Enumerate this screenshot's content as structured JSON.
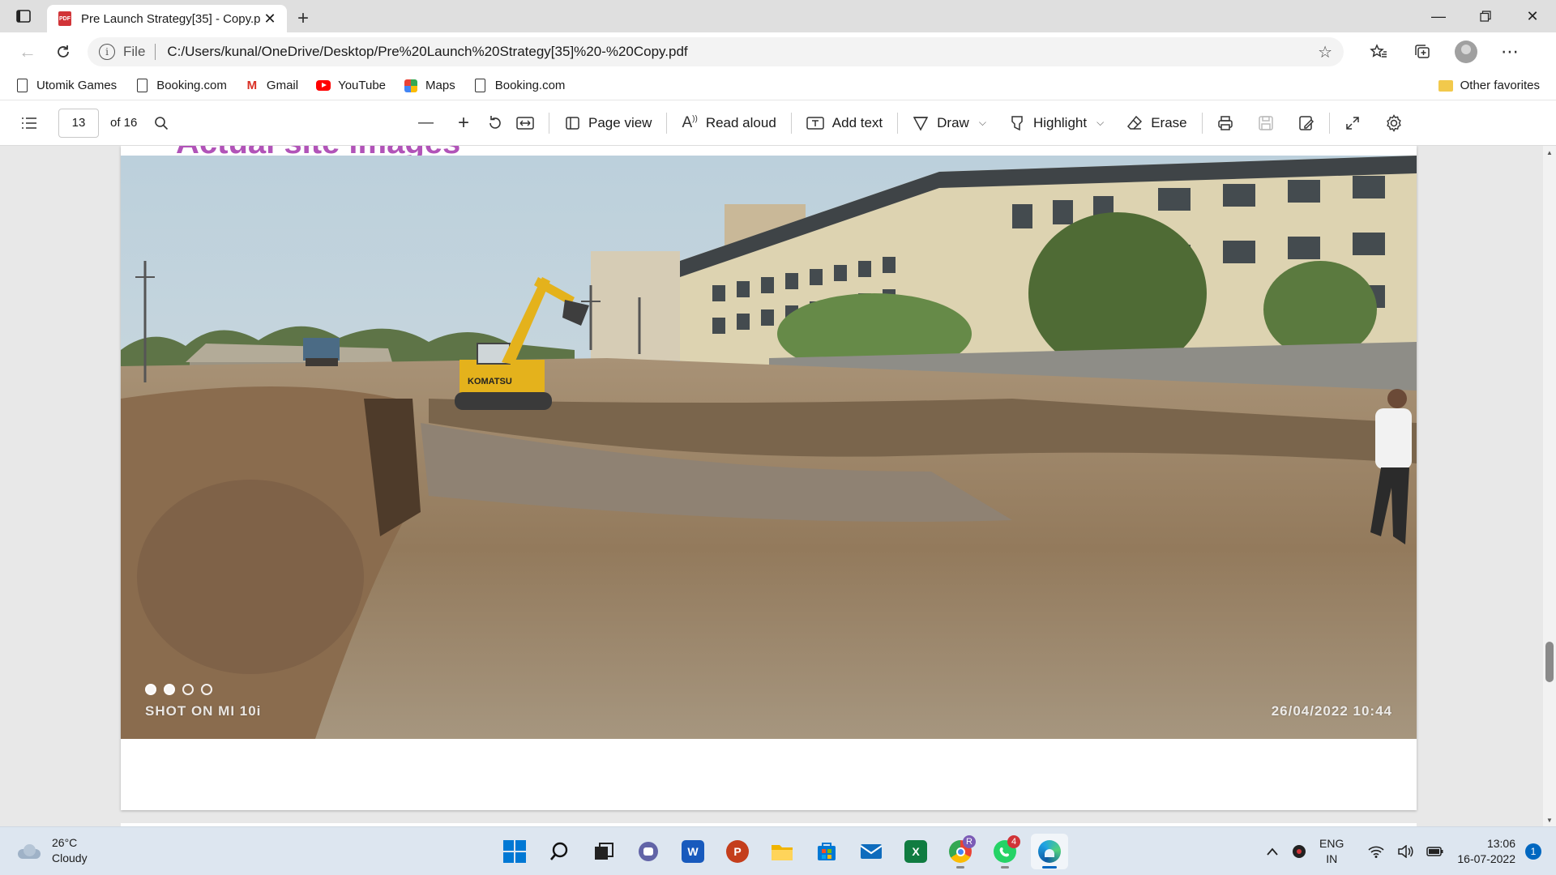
{
  "browser": {
    "tab_title": "Pre Launch Strategy[35] - Copy.p",
    "pdf_badge": "PDF",
    "url_protocol": "File",
    "url": "C:/Users/kunal/OneDrive/Desktop/Pre%20Launch%20Strategy[35]%20-%20Copy.pdf"
  },
  "favorites": {
    "items": [
      {
        "label": "Utomik Games",
        "icon": "document-icon"
      },
      {
        "label": "Booking.com",
        "icon": "document-icon"
      },
      {
        "label": "Gmail",
        "icon": "gmail-icon"
      },
      {
        "label": "YouTube",
        "icon": "youtube-icon"
      },
      {
        "label": "Maps",
        "icon": "maps-icon"
      },
      {
        "label": "Booking.com",
        "icon": "document-icon"
      }
    ],
    "other": "Other favorites"
  },
  "pdf_toolbar": {
    "page_current": "13",
    "page_total": "of 16",
    "page_view": "Page view",
    "read_aloud": "Read aloud",
    "add_text": "Add text",
    "draw": "Draw",
    "highlight": "Highlight",
    "erase": "Erase"
  },
  "document": {
    "heading": "Actual site images",
    "photo_stamp_left": "SHOT ON MI 10i",
    "photo_stamp_right": "26/04/2022  10:44",
    "excavator_label": "KOMATSU"
  },
  "taskbar": {
    "temperature": "26°C",
    "condition": "Cloudy",
    "lang_top": "ENG",
    "lang_bottom": "IN",
    "time": "13:06",
    "date": "16-07-2022",
    "notifications": "1",
    "whatsapp_badge": "4",
    "chrome_badge": "R",
    "word_glyph": "W",
    "powerpoint_glyph": "P",
    "excel_glyph": "X"
  },
  "colors": {
    "heading_color": "#b153b8",
    "accent": "#0067c0",
    "pdf_icon": "#d13438"
  }
}
